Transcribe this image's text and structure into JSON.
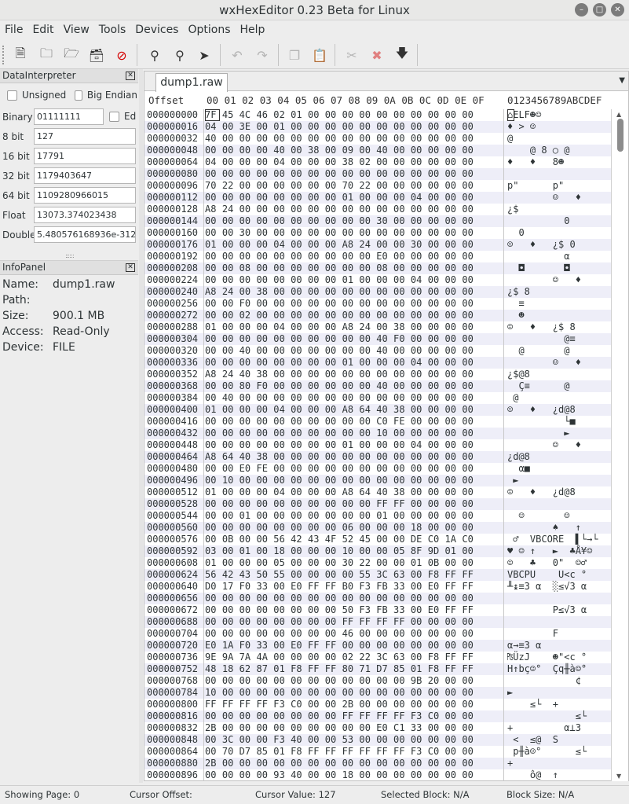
{
  "window": {
    "title": "wxHexEditor 0.23 Beta for Linux"
  },
  "menubar": [
    "File",
    "Edit",
    "View",
    "Tools",
    "Devices",
    "Options",
    "Help"
  ],
  "toolbar_icons": [
    "new-file-icon",
    "open-file-icon",
    "open-device-icon",
    "open-process-icon",
    "close-file-icon",
    "find-icon",
    "find-replace-icon",
    "goto-offset-icon",
    "undo-icon",
    "redo-icon",
    "copy-icon",
    "paste-icon",
    "cut-icon",
    "delete-icon",
    "insert-icon"
  ],
  "data_interpreter": {
    "title": "DataInterpreter",
    "unsigned_label": "Unsigned",
    "big_endian_label": "Big Endian",
    "edit_label": "Ed",
    "rows": [
      {
        "label": "Binary",
        "value": "01111111"
      },
      {
        "label": "8 bit",
        "value": "127"
      },
      {
        "label": "16 bit",
        "value": "17791"
      },
      {
        "label": "32 bit",
        "value": "1179403647"
      },
      {
        "label": "64 bit",
        "value": "1109280966015"
      },
      {
        "label": "Float",
        "value": "13073.374023438"
      },
      {
        "label": "Double",
        "value": "5.480576168936e-312"
      }
    ]
  },
  "info_panel": {
    "title": "InfoPanel",
    "rows": [
      {
        "label": "Name:",
        "value": "dump1.raw"
      },
      {
        "label": "Path:",
        "value": ""
      },
      {
        "label": "Size:",
        "value": "900.1 MB"
      },
      {
        "label": "Access:",
        "value": "Read-Only"
      },
      {
        "label": "Device:",
        "value": "FILE"
      }
    ]
  },
  "editor": {
    "tab_label": "dump1.raw",
    "offset_header": "Offset",
    "hex_header": "00 01 02 03 04 05 06 07 08 09 0A 0B 0C 0D 0E 0F",
    "text_header": "0123456789ABCDEF",
    "rows": [
      {
        "offset": "000000000",
        "hex": "7F 45 4C 46 02 01 00 00 00 00 00 00 00 00 00 00",
        "text": "⌂ELF☻☺"
      },
      {
        "offset": "000000016",
        "hex": "04 00 3E 00 01 00 00 00 00 00 00 00 00 00 00 00",
        "text": "♦ > ☺"
      },
      {
        "offset": "000000032",
        "hex": "40 00 00 00 00 00 00 00 00 00 00 00 00 00 00 00",
        "text": "@"
      },
      {
        "offset": "000000048",
        "hex": "00 00 00 00 40 00 38 00 09 00 40 00 00 00 00 00",
        "text": "    @ 8 ○ @"
      },
      {
        "offset": "000000064",
        "hex": "04 00 00 00 04 00 00 00 38 02 00 00 00 00 00 00",
        "text": "♦   ♦   8☻"
      },
      {
        "offset": "000000080",
        "hex": "00 00 00 00 00 00 00 00 00 00 00 00 00 00 00 00",
        "text": ""
      },
      {
        "offset": "000000096",
        "hex": "70 22 00 00 00 00 00 00 70 22 00 00 00 00 00 00",
        "text": "p\"      p\""
      },
      {
        "offset": "000000112",
        "hex": "00 00 00 00 00 00 00 00 01 00 00 00 04 00 00 00",
        "text": "        ☺   ♦"
      },
      {
        "offset": "000000128",
        "hex": "A8 24 00 00 00 00 00 00 00 00 00 00 00 00 00 00",
        "text": "¿$"
      },
      {
        "offset": "000000144",
        "hex": "00 00 00 00 00 00 00 00 00 00 30 00 00 00 00 00",
        "text": "          0"
      },
      {
        "offset": "000000160",
        "hex": "00 00 30 00 00 00 00 00 00 00 00 00 00 00 00 00",
        "text": "  0"
      },
      {
        "offset": "000000176",
        "hex": "01 00 00 00 04 00 00 00 A8 24 00 00 30 00 00 00",
        "text": "☺   ♦   ¿$ 0"
      },
      {
        "offset": "000000192",
        "hex": "00 00 00 00 00 00 00 00 00 00 E0 00 00 00 00 00",
        "text": "          α"
      },
      {
        "offset": "000000208",
        "hex": "00 00 08 00 00 00 00 00 00 00 08 00 00 00 00 00",
        "text": "  ◘       ◘"
      },
      {
        "offset": "000000224",
        "hex": "00 00 00 00 00 00 00 00 01 00 00 00 04 00 00 00",
        "text": "        ☺   ♦"
      },
      {
        "offset": "000000240",
        "hex": "A8 24 00 38 00 00 00 00 00 00 00 00 00 00 00 00",
        "text": "¿$ 8"
      },
      {
        "offset": "000000256",
        "hex": "00 00 F0 00 00 00 00 00 00 00 00 00 00 00 00 00",
        "text": "  ≡"
      },
      {
        "offset": "000000272",
        "hex": "00 00 02 00 00 00 00 00 00 00 00 00 00 00 00 00",
        "text": "  ☻"
      },
      {
        "offset": "000000288",
        "hex": "01 00 00 00 04 00 00 00 A8 24 00 38 00 00 00 00",
        "text": "☺   ♦   ¿$ 8"
      },
      {
        "offset": "000000304",
        "hex": "00 00 00 00 00 00 00 00 00 00 40 F0 00 00 00 00",
        "text": "          @≡"
      },
      {
        "offset": "000000320",
        "hex": "00 00 40 00 00 00 00 00 00 00 40 00 00 00 00 00",
        "text": "  @       @"
      },
      {
        "offset": "000000336",
        "hex": "00 00 00 00 00 00 00 00 01 00 00 00 04 00 00 00",
        "text": "        ☺   ♦"
      },
      {
        "offset": "000000352",
        "hex": "A8 24 40 38 00 00 00 00 00 00 00 00 00 00 00 00",
        "text": "¿$@8"
      },
      {
        "offset": "000000368",
        "hex": "00 00 80 F0 00 00 00 00 00 00 40 00 00 00 00 00",
        "text": "  Ç≡      @"
      },
      {
        "offset": "000000384",
        "hex": "00 40 00 00 00 00 00 00 00 00 00 00 00 00 00 00",
        "text": " @"
      },
      {
        "offset": "000000400",
        "hex": "01 00 00 00 04 00 00 00 A8 64 40 38 00 00 00 00",
        "text": "☺   ♦   ¿d@8"
      },
      {
        "offset": "000000416",
        "hex": "00 00 00 00 00 00 00 00 00 00 C0 FE 00 00 00 00",
        "text": "          └■"
      },
      {
        "offset": "000000432",
        "hex": "00 00 00 00 00 00 00 00 00 00 10 00 00 00 00 00",
        "text": "          ►"
      },
      {
        "offset": "000000448",
        "hex": "00 00 00 00 00 00 00 00 01 00 00 00 04 00 00 00",
        "text": "        ☺   ♦"
      },
      {
        "offset": "000000464",
        "hex": "A8 64 40 38 00 00 00 00 00 00 00 00 00 00 00 00",
        "text": "¿d@8"
      },
      {
        "offset": "000000480",
        "hex": "00 00 E0 FE 00 00 00 00 00 00 00 00 00 00 00 00",
        "text": "  α■"
      },
      {
        "offset": "000000496",
        "hex": "00 10 00 00 00 00 00 00 00 00 00 00 00 00 00 00",
        "text": " ►"
      },
      {
        "offset": "000000512",
        "hex": "01 00 00 00 04 00 00 00 A8 64 40 38 00 00 00 00",
        "text": "☺   ♦   ¿d@8"
      },
      {
        "offset": "000000528",
        "hex": "00 00 00 00 00 00 00 00 00 00 FF FF 00 00 00 00",
        "text": ""
      },
      {
        "offset": "000000544",
        "hex": "00 00 01 00 00 00 00 00 00 00 01 00 00 00 00 00",
        "text": "  ☺       ☺"
      },
      {
        "offset": "000000560",
        "hex": "00 00 00 00 00 00 00 00 06 00 00 00 18 00 00 00",
        "text": "        ♠   ↑"
      },
      {
        "offset": "000000576",
        "hex": "00 0B 00 00 56 42 43 4F 52 45 00 00 DE C0 1A C0",
        "text": " ♂  VBCORE  ▌└→└"
      },
      {
        "offset": "000000592",
        "hex": "03 00 01 00 18 00 00 00 10 00 00 05 8F 9D 01 00",
        "text": "♥ ☺ ↑   ►  ♣Å¥☺"
      },
      {
        "offset": "000000608",
        "hex": "01 00 00 00 05 00 00 00 30 22 00 00 01 0B 00 00",
        "text": "☺   ♣   0\"  ☺♂"
      },
      {
        "offset": "000000624",
        "hex": "56 42 43 50 55 00 00 00 00 55 3C 63 00 F8 FF FF",
        "text": "VBCPU    U<c °"
      },
      {
        "offset": "000000640",
        "hex": "D0 17 F0 33 00 E0 FF FF B0 F3 FB 33 00 E0 FF FF",
        "text": "╨↨≡3 α  ░≤√3 α"
      },
      {
        "offset": "000000656",
        "hex": "00 00 00 00 00 00 00 00 00 00 00 00 00 00 00 00",
        "text": ""
      },
      {
        "offset": "000000672",
        "hex": "00 00 00 00 00 00 00 00 50 F3 FB 33 00 E0 FF FF",
        "text": "        P≤√3 α"
      },
      {
        "offset": "000000688",
        "hex": "00 00 00 00 00 00 00 00 FF FF FF FF 00 00 00 00",
        "text": ""
      },
      {
        "offset": "000000704",
        "hex": "00 00 00 00 00 00 00 00 46 00 00 00 00 00 00 00",
        "text": "        F"
      },
      {
        "offset": "000000720",
        "hex": "E0 1A F0 33 00 E0 FF FF 00 00 00 00 00 00 00 00",
        "text": "α→≡3 α"
      },
      {
        "offset": "000000736",
        "hex": "9E 9A 7A 4A 00 00 00 00 02 22 3C 63 00 F8 FF FF",
        "text": "₧ÜzJ    ☻\"<c °"
      },
      {
        "offset": "000000752",
        "hex": "48 18 62 87 01 F8 FF FF 80 71 D7 85 01 F8 FF FF",
        "text": "H↑bç☺°  Çq╫à☺°"
      },
      {
        "offset": "000000768",
        "hex": "00 00 00 00 00 00 00 00 00 00 00 00 9B 20 00 00",
        "text": "            ¢"
      },
      {
        "offset": "000000784",
        "hex": "10 00 00 00 00 00 00 00 00 00 00 00 00 00 00 00",
        "text": "►"
      },
      {
        "offset": "000000800",
        "hex": "FF FF FF FF F3 C0 00 00 2B 00 00 00 00 00 00 00",
        "text": "    ≤└  +"
      },
      {
        "offset": "000000816",
        "hex": "00 00 00 00 00 00 00 00 FF FF FF FF F3 C0 00 00",
        "text": "            ≤└"
      },
      {
        "offset": "000000832",
        "hex": "2B 00 00 00 00 00 00 00 00 00 E0 C1 33 00 00 00",
        "text": "+         α⊥3"
      },
      {
        "offset": "000000848",
        "hex": "00 3C 00 00 F3 40 00 00 53 00 00 00 00 00 00 00",
        "text": " <  ≤@  S"
      },
      {
        "offset": "000000864",
        "hex": "00 70 D7 85 01 F8 FF FF FF FF FF FF F3 C0 00 00",
        "text": " p╫à☺°      ≤└"
      },
      {
        "offset": "000000880",
        "hex": "2B 00 00 00 00 00 00 00 00 00 00 00 00 00 00 00",
        "text": "+"
      },
      {
        "offset": "000000896",
        "hex": "00 00 00 00 93 40 00 00 18 00 00 00 00 00 00 00",
        "text": "    ô@  ↑"
      }
    ]
  },
  "status_bar": {
    "page": "Showing Page: 0",
    "cursor_offset": "Cursor Offset:",
    "cursor_value": "Cursor Value: 127",
    "selected_block": "Selected Block: N/A",
    "block_size": "Block Size: N/A"
  }
}
